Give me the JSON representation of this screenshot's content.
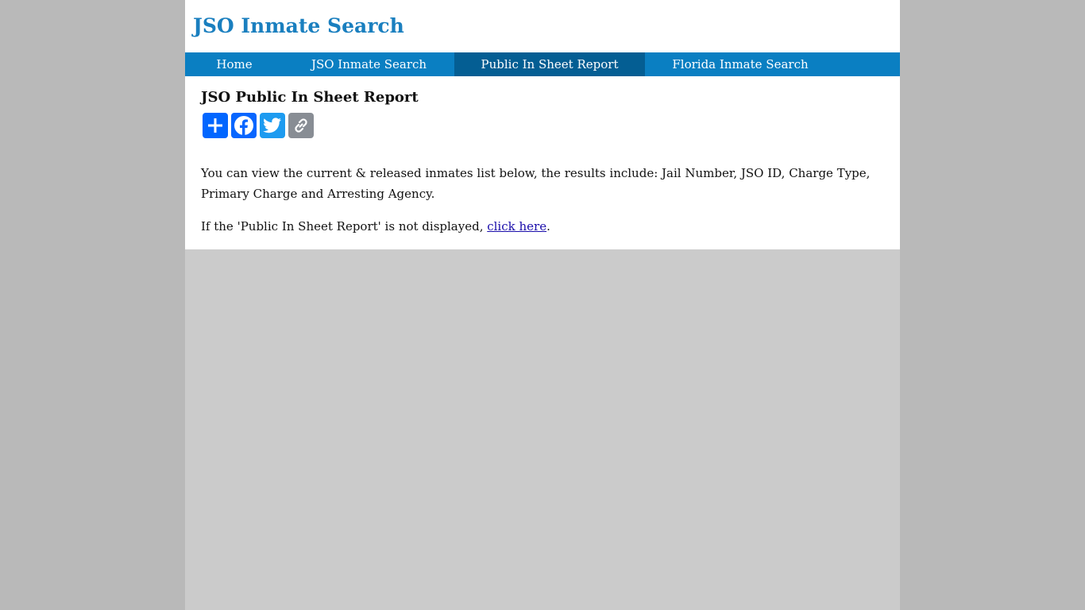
{
  "header": {
    "site_title": "JSO Inmate Search"
  },
  "nav": {
    "items": [
      {
        "label": "Home"
      },
      {
        "label": "JSO Inmate Search"
      },
      {
        "label": "Public In Sheet Report"
      },
      {
        "label": "Florida Inmate Search"
      }
    ],
    "active_index": 2
  },
  "main": {
    "heading": "JSO Public In Sheet Report",
    "share_buttons": [
      {
        "icon": "plus-share-icon",
        "color": "#0166ff"
      },
      {
        "icon": "facebook-icon",
        "color": "#0866ff"
      },
      {
        "icon": "twitter-icon",
        "color": "#1d9bf0"
      },
      {
        "icon": "copy-link-icon",
        "color": "#888d94"
      }
    ],
    "intro": "You can view the current & released inmates list below, the results include: Jail Number, JSO ID, Charge Type, Primary Charge and Arresting Agency.",
    "note_prefix": "If the 'Public In Sheet Report' is not displayed, ",
    "note_link": "click here",
    "note_suffix": "."
  },
  "colors": {
    "brand": "#1a7fbf",
    "nav_bg": "#0a7fc2",
    "nav_active": "#045e93",
    "link": "#1a0dab"
  }
}
